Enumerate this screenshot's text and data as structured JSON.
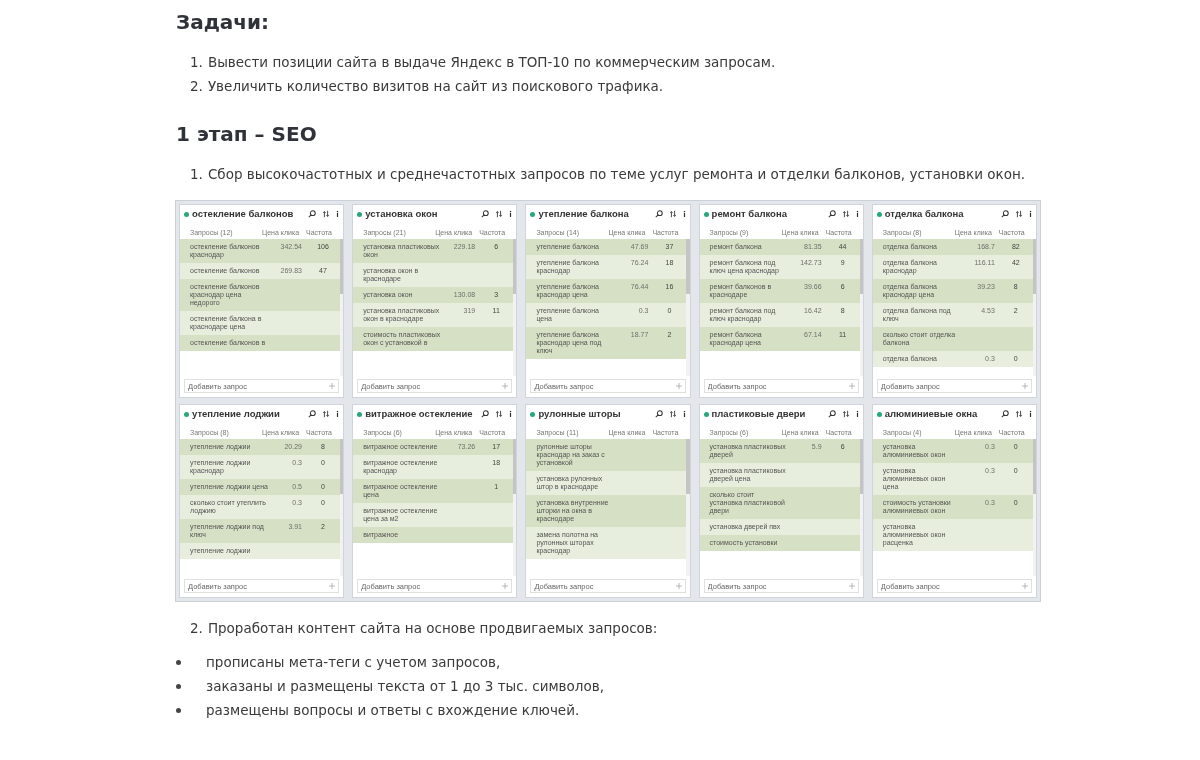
{
  "heading_tasks": "Задачи:",
  "tasks": [
    {
      "number": "1.",
      "text": "Вывести позиции сайта в выдаче Яндекс в ТОП-10 по коммерческим запросам."
    },
    {
      "number": "2.",
      "text": "Увеличить количество визитов на сайт из поискового трафика."
    }
  ],
  "heading_stage": "1 этап – SEO",
  "step_1": {
    "number": "1.",
    "text": "Сбор высокочастотных и среднечастотных запросов по теме услуг ремонта и отделки балконов, установки окон."
  },
  "tool": {
    "groups": [
      {
        "title": "остекление балконов",
        "count": "Запросы (12)",
        "col_price": "Цена клика",
        "col_freq": "Частота",
        "add_placeholder": "Добавить запрос",
        "rows": [
          {
            "query": "остекление балконов краснодар",
            "price": "342.54",
            "freq": "106"
          },
          {
            "query": "остекление балконов",
            "price": "269.83",
            "freq": "47"
          },
          {
            "query": "остекление балконов краснодар цена недорого"
          },
          {
            "query": "остекление балкона в краснодаре цена"
          },
          {
            "query": "остекление балконов в"
          }
        ]
      },
      {
        "title": "установка окон",
        "count": "Запросы (21)",
        "col_price": "Цена клика",
        "col_freq": "Частота",
        "add_placeholder": "Добавить запрос",
        "rows": [
          {
            "query": "установка пластиковых окон",
            "price": "229.18",
            "freq": "6"
          },
          {
            "query": "установка окон в краснодаре"
          },
          {
            "query": "установка окон",
            "price": "130.08",
            "freq": "3"
          },
          {
            "query": "установка пластиковых окон в краснодаре",
            "price": "319",
            "freq": "11"
          },
          {
            "query": "стоимость пластиковых окон с установкой в"
          }
        ]
      },
      {
        "title": "утепление балкона",
        "count": "Запросы (14)",
        "col_price": "Цена клика",
        "col_freq": "Частота",
        "add_placeholder": "Добавить запрос",
        "rows": [
          {
            "query": "утепление балкона",
            "price": "47.69",
            "freq": "37"
          },
          {
            "query": "утепление балкона краснодар",
            "price": "76.24",
            "freq": "18"
          },
          {
            "query": "утепление балкона краснодар цена",
            "price": "76.44",
            "freq": "16"
          },
          {
            "query": "утепление балкона цена",
            "price": "0.3",
            "freq": "0"
          },
          {
            "query": "утепление балкона краснодар цена под ключ",
            "price": "18.77",
            "freq": "2"
          }
        ]
      },
      {
        "title": "ремонт балкона",
        "count": "Запросы (9)",
        "col_price": "Цена клика",
        "col_freq": "Частота",
        "add_placeholder": "Добавить запрос",
        "rows": [
          {
            "query": "ремонт балкона",
            "price": "81.35",
            "freq": "44"
          },
          {
            "query": "ремонт балкона под ключ цена краснодар",
            "price": "142.73",
            "freq": "9"
          },
          {
            "query": "ремонт балконов в краснодаре",
            "price": "39.66",
            "freq": "6"
          },
          {
            "query": "ремонт балкона под ключ краснодар",
            "price": "16.42",
            "freq": "8"
          },
          {
            "query": "ремонт балкона краснодар цена",
            "price": "67.14",
            "freq": "11"
          }
        ]
      },
      {
        "title": "отделка балкона",
        "count": "Запросы (8)",
        "col_price": "Цена клика",
        "col_freq": "Частота",
        "add_placeholder": "Добавить запрос",
        "rows": [
          {
            "query": "отделка балкона",
            "price": "168.7",
            "freq": "82"
          },
          {
            "query": "отделка балкона краснодар",
            "price": "116.11",
            "freq": "42"
          },
          {
            "query": "отделка балкона краснодар цена",
            "price": "39.23",
            "freq": "8"
          },
          {
            "query": "отделка балкона под ключ",
            "price": "4.53",
            "freq": "2"
          },
          {
            "query": "сколько стоит отделка балкона"
          },
          {
            "query": "отделка балкона",
            "price": "0.3",
            "freq": "0"
          }
        ]
      },
      {
        "title": "утепление лоджии",
        "count": "Запросы (8)",
        "col_price": "Цена клика",
        "col_freq": "Частота",
        "add_placeholder": "Добавить запрос",
        "rows": [
          {
            "query": "утепление лоджии",
            "price": "20.29",
            "freq": "8"
          },
          {
            "query": "утепление лоджии краснодар",
            "price": "0.3",
            "freq": "0"
          },
          {
            "query": "утепление лоджии цена",
            "price": "0.5",
            "freq": "0"
          },
          {
            "query": "сколько стоит утеплить лоджию",
            "price": "0.3",
            "freq": "0"
          },
          {
            "query": "утепление лоджии под ключ",
            "price": "3.91",
            "freq": "2"
          },
          {
            "query": "утепление лоджии"
          }
        ]
      },
      {
        "title": "витражное остекление",
        "count": "Запросы (6)",
        "col_price": "Цена клика",
        "col_freq": "Частота",
        "add_placeholder": "Добавить запрос",
        "rows": [
          {
            "query": "витражное остекление",
            "price": "73.26",
            "freq": "17"
          },
          {
            "query": "витражное остекление краснодар",
            "freq": "18"
          },
          {
            "query": "витражное остекление цена",
            "freq": "1"
          },
          {
            "query": "витражное остекление цена за м2"
          },
          {
            "query": "витражное"
          }
        ]
      },
      {
        "title": "рулонные шторы",
        "count": "Запросы (11)",
        "col_price": "Цена клика",
        "col_freq": "Частота",
        "add_placeholder": "Добавить запрос",
        "rows": [
          {
            "query": "рулонные шторы краснодар на заказ с установкой"
          },
          {
            "query": "установка рулонных штор в краснодаре"
          },
          {
            "query": "установка внутренние шторки на окна в краснодаре"
          },
          {
            "query": "замена полотна на рулонных шторах краснодар"
          }
        ]
      },
      {
        "title": "пластиковые двери",
        "count": "Запросы (6)",
        "col_price": "Цена клика",
        "col_freq": "Частота",
        "add_placeholder": "Добавить запрос",
        "rows": [
          {
            "query": "установка пластиковых дверей",
            "price": "5.9",
            "freq": "6"
          },
          {
            "query": "установка пластиковых дверей цена"
          },
          {
            "query": "сколько стоит установка пластиковой двери"
          },
          {
            "query": "установка дверей пвх"
          },
          {
            "query": "стоимость установки"
          }
        ]
      },
      {
        "title": "алюминиевые окна",
        "count": "Запросы (4)",
        "col_price": "Цена клика",
        "col_freq": "Частота",
        "add_placeholder": "Добавить запрос",
        "rows": [
          {
            "query": "установка алюминиевых окон",
            "price": "0.3",
            "freq": "0"
          },
          {
            "query": "установка алюминиевых окон цена",
            "price": "0.3",
            "freq": "0"
          },
          {
            "query": "стоимость установки алюминиевых окон",
            "price": "0.3",
            "freq": "0"
          },
          {
            "query": "установка алюминиевых окон расценка"
          }
        ]
      }
    ]
  },
  "step_2": {
    "number": "2.",
    "text": "Проработан контент сайта на основе продвигаемых запросов:"
  },
  "bullets": [
    "прописаны мета-теги с учетом запросов,",
    "заказаны и размещены текста от 1 до 3 тыс. символов,",
    "размещены вопросы и ответы с вхождение ключей."
  ]
}
